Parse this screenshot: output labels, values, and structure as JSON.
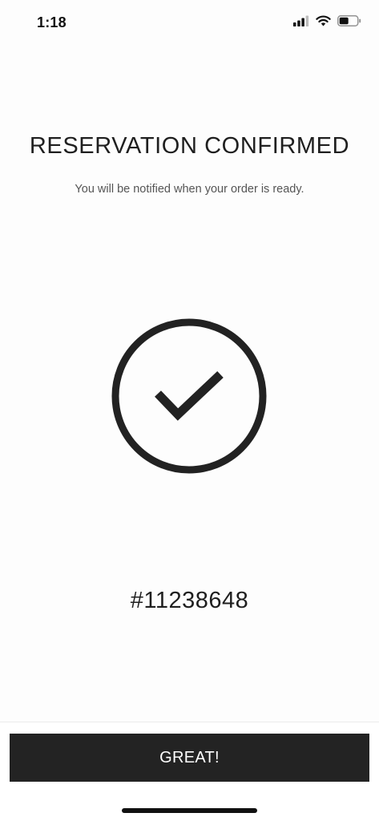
{
  "status_bar": {
    "time": "1:18",
    "icons": [
      "cellular-signal-icon",
      "wifi-icon",
      "battery-icon"
    ]
  },
  "confirmation": {
    "title": "RESERVATION CONFIRMED",
    "subtitle": "You will be notified when your order is ready.",
    "icon": "checkmark-circle-icon",
    "order_number": "#11238648"
  },
  "actions": {
    "great_label": "GREAT!"
  },
  "colors": {
    "primary_dark": "#232323",
    "text": "#1f1f1f",
    "subtext": "#555555",
    "background": "#fdfdfd"
  }
}
